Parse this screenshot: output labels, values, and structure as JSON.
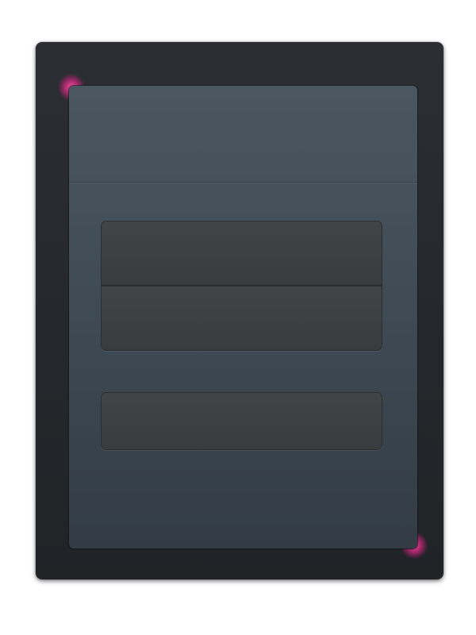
{
  "header": {
    "title": ""
  },
  "form": {
    "group_one": {
      "field_one": {
        "value": "",
        "placeholder": ""
      },
      "field_two": {
        "value": "",
        "placeholder": ""
      }
    },
    "group_two": {
      "field_one": {
        "value": "",
        "placeholder": ""
      }
    }
  },
  "colors": {
    "device_frame": "#272b2f",
    "panel": "#44505a",
    "field": "#3c3f41",
    "accent_glow": "#e8288c"
  }
}
